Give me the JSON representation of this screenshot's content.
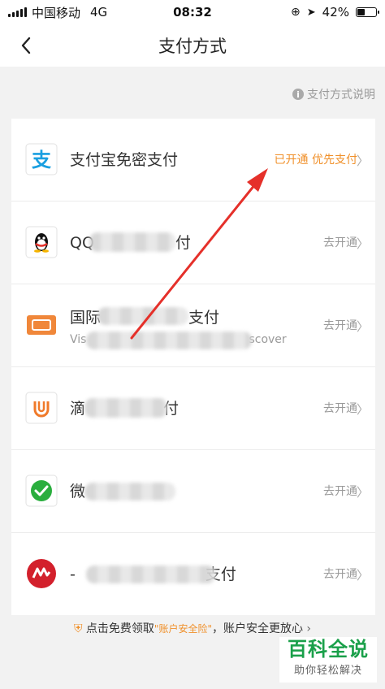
{
  "status_bar": {
    "carrier": "中国移动",
    "network": "4G",
    "time": "08:32",
    "battery": "42%",
    "battery_level": 0.42
  },
  "nav": {
    "title": "支付方式"
  },
  "help": {
    "label": "支付方式说明"
  },
  "methods": [
    {
      "name": "支付宝免密支付",
      "status": "已开通 优先支付",
      "active": true,
      "icon": "alipay-icon"
    },
    {
      "name": "QQ",
      "name_end": "付",
      "status": "去开通",
      "active": false,
      "icon": "qq-icon"
    },
    {
      "name": "国际",
      "name_end": "支付",
      "sub": "Vis",
      "sub_end": "scover",
      "status": "去开通",
      "active": false,
      "icon": "card-icon"
    },
    {
      "name": "滴",
      "name_end": "付",
      "status": "去开通",
      "active": false,
      "icon": "didi-icon"
    },
    {
      "name": "微",
      "status": "去开通",
      "active": false,
      "icon": "wechat-icon"
    },
    {
      "name": "-",
      "name_end": "支付",
      "status": "去开通",
      "active": false,
      "icon": "union-icon"
    }
  ],
  "footer": {
    "prefix": "点击免费领取",
    "highlight": "\"账户安全险\"",
    "suffix": "，账户安全更放心"
  },
  "watermark": {
    "title": "百科全说",
    "subtitle": "助你轻松解决"
  },
  "colors": {
    "accent": "#f0902a",
    "annotation": "#e5302a"
  }
}
